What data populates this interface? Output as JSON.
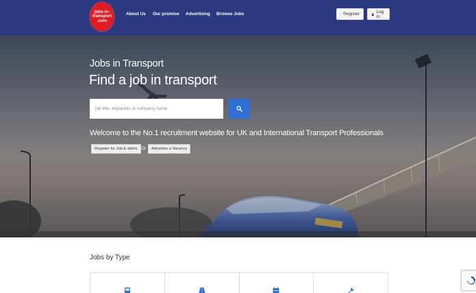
{
  "header": {
    "logo_lines": [
      "jobs-in-",
      "transport",
      ".com"
    ],
    "nav": [
      {
        "label": "About Us"
      },
      {
        "label": "Our promise"
      },
      {
        "label": "Advertising"
      },
      {
        "label": "Browse Jobs"
      }
    ],
    "register_label": "Register",
    "login_label": "Log In"
  },
  "hero": {
    "subtitle": "Jobs in Transport",
    "title": "Find a job in transport",
    "search_placeholder": "job title, keywords or company name",
    "welcome": "Welcome to the No.1 recruitment website for UK and International Transport Professionals",
    "register_alerts_label": "Register for Job E-alerts",
    "or_label": "Or",
    "advertise_label": "Advertise a Vacancy"
  },
  "jobs_by_type": {
    "title": "Jobs by Type",
    "types": [
      {
        "icon": "bus-icon"
      },
      {
        "icon": "road-icon"
      },
      {
        "icon": "calendar-icon"
      },
      {
        "icon": "wrench-icon"
      }
    ]
  },
  "colors": {
    "header_bg": "#2b3a7f",
    "logo_red": "#e21b22",
    "search_button": "#2f6fd6",
    "icon_blue": "#2f6fd6"
  }
}
